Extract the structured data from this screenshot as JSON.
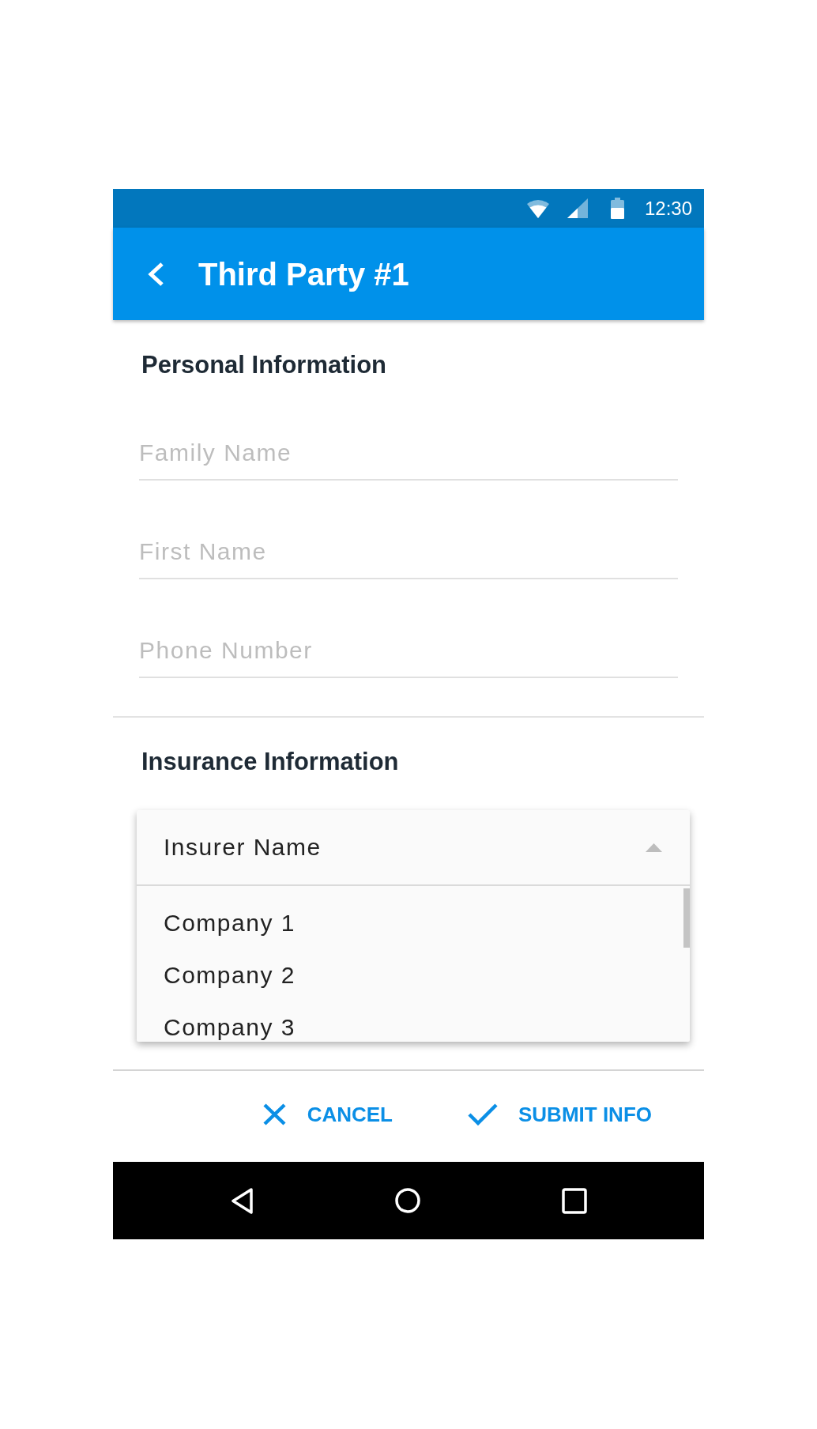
{
  "status_bar": {
    "time": "12:30"
  },
  "app_bar": {
    "title": "Third Party #1"
  },
  "sections": [
    {
      "kind": "fields",
      "title": "Personal Information",
      "fields": [
        {
          "placeholder": "Family Name"
        },
        {
          "placeholder": "First Name"
        },
        {
          "placeholder": "Phone Number"
        }
      ]
    },
    {
      "kind": "dropdown",
      "title": "Insurance Information",
      "dropdown": {
        "label": "Insurer Name",
        "expanded": true,
        "options": [
          {
            "label": "Company 1",
            "selected": false
          },
          {
            "label": "Company 2",
            "selected": false
          },
          {
            "label": "Company 3",
            "selected": false
          }
        ]
      }
    }
  ],
  "actions": [
    {
      "kind": "cancel",
      "label": "CANCEL"
    },
    {
      "kind": "submit",
      "label": "SUBMIT INFO"
    }
  ]
}
